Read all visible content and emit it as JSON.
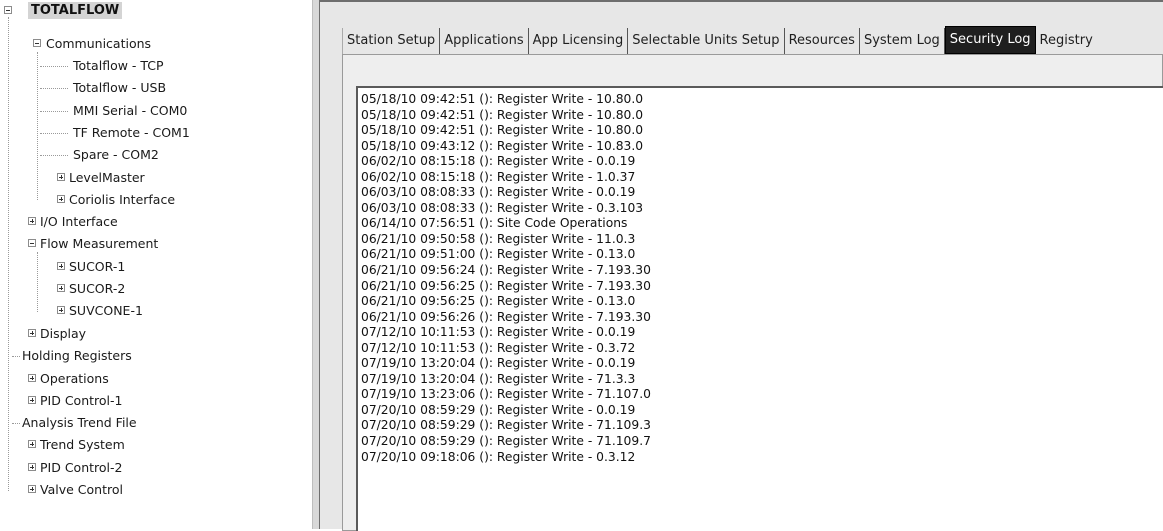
{
  "tree": {
    "root": "TOTALFLOW",
    "items": {
      "communications": "Communications",
      "totalflow_tcp": "Totalflow - TCP",
      "totalflow_usb": "Totalflow - USB",
      "mmi_serial": "MMI Serial - COM0",
      "tf_remote": "TF Remote - COM1",
      "spare": "Spare - COM2",
      "levelmaster": "LevelMaster",
      "coriolis": "Coriolis Interface",
      "io_interface": "I/O Interface",
      "flow_measurement": "Flow Measurement",
      "sucor1": "SUCOR-1",
      "sucor2": "SUCOR-2",
      "suvcone1": "SUVCONE-1",
      "display": "Display",
      "holding_registers": "Holding Registers",
      "operations": "Operations",
      "pid_control_1": "PID Control-1",
      "analysis_trend_file": "Analysis Trend File",
      "trend_system": "Trend System",
      "pid_control_2": "PID Control-2",
      "valve_control": "Valve Control"
    }
  },
  "tabs": {
    "station_setup": "Station Setup",
    "applications": "Applications",
    "app_licensing": "App Licensing",
    "selectable_units_setup": "Selectable Units Setup",
    "resources": "Resources",
    "system_log": "System Log",
    "security_log": "Security Log",
    "registry": "Registry",
    "active": "Security Log"
  },
  "security_log": [
    "05/18/10 09:42:51 (): Register Write - 10.80.0",
    "05/18/10 09:42:51 (): Register Write - 10.80.0",
    "05/18/10 09:42:51 (): Register Write - 10.80.0",
    "05/18/10 09:43:12 (): Register Write - 10.83.0",
    "06/02/10 08:15:18 (): Register Write - 0.0.19",
    "06/02/10 08:15:18 (): Register Write - 1.0.37",
    "06/03/10 08:08:33 (): Register Write - 0.0.19",
    "06/03/10 08:08:33 (): Register Write - 0.3.103",
    "06/14/10 07:56:51 (): Site Code Operations",
    "06/21/10 09:50:58 (): Register Write - 11.0.3",
    "06/21/10 09:51:00 (): Register Write - 0.13.0",
    "06/21/10 09:56:24 (): Register Write - 7.193.30",
    "06/21/10 09:56:25 (): Register Write - 7.193.30",
    "06/21/10 09:56:25 (): Register Write - 0.13.0",
    "06/21/10 09:56:26 (): Register Write - 7.193.30",
    "07/12/10 10:11:53 (): Register Write - 0.0.19",
    "07/12/10 10:11:53 (): Register Write - 0.3.72",
    "07/19/10 13:20:04 (): Register Write - 0.0.19",
    "07/19/10 13:20:04 (): Register Write - 71.3.3",
    "07/19/10 13:23:06 (): Register Write - 71.107.0",
    "07/20/10 08:59:29 (): Register Write - 0.0.19",
    "07/20/10 08:59:29 (): Register Write - 71.109.3",
    "07/20/10 08:59:29 (): Register Write - 71.109.7",
    "07/20/10 09:18:06 (): Register Write - 0.3.12"
  ]
}
